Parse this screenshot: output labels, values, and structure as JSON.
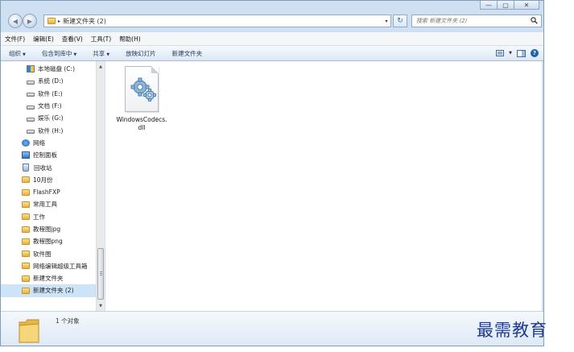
{
  "window": {
    "caption_buttons": {
      "minimize": "—",
      "maximize": "▢",
      "close": "✕"
    }
  },
  "address": {
    "path": "新建文件夹 (2)",
    "separator": "▸",
    "dropdown": "▾",
    "refresh": "↻"
  },
  "search": {
    "placeholder": "搜索 新建文件夹 (2)"
  },
  "menu": [
    "文件(F)",
    "编辑(E)",
    "查看(V)",
    "工具(T)",
    "帮助(H)"
  ],
  "toolbar": {
    "organize": "组织",
    "include_in_library": "包含到库中",
    "share": "共享",
    "slideshow": "放映幻灯片",
    "new_folder": "新建文件夹",
    "dropdown_arrow": "▼",
    "help": "?"
  },
  "nav": {
    "items": [
      {
        "label": "本地磁盘 (C:)",
        "icon": "system-drive-icon"
      },
      {
        "label": "系统 (D:)",
        "icon": "drive-icon"
      },
      {
        "label": "软件 (E:)",
        "icon": "drive-icon"
      },
      {
        "label": "文档 (F:)",
        "icon": "drive-icon"
      },
      {
        "label": "娱乐 (G:)",
        "icon": "drive-icon"
      },
      {
        "label": "软件 (H:)",
        "icon": "drive-icon"
      },
      {
        "label": "网络",
        "icon": "network-icon"
      },
      {
        "label": "控制面板",
        "icon": "control-panel-icon"
      },
      {
        "label": "回收站",
        "icon": "recycle-bin-icon"
      },
      {
        "label": "10月份",
        "icon": "folder-icon"
      },
      {
        "label": "FlashFXP",
        "icon": "folder-icon"
      },
      {
        "label": "常用工具",
        "icon": "folder-icon"
      },
      {
        "label": "工作",
        "icon": "folder-icon"
      },
      {
        "label": "教程图jpg",
        "icon": "folder-icon"
      },
      {
        "label": "教程图png",
        "icon": "folder-icon"
      },
      {
        "label": "软件图",
        "icon": "folder-icon"
      },
      {
        "label": "网络编辑超级工具箱",
        "icon": "folder-icon"
      },
      {
        "label": "新建文件夹",
        "icon": "folder-icon"
      },
      {
        "label": "新建文件夹 (2)",
        "icon": "folder-icon",
        "selected": true
      }
    ],
    "scroll_up": "▲",
    "scroll_down": "▼"
  },
  "content": {
    "files": [
      {
        "name": "WindowsCodecs.dll",
        "icon": "dll-gear-icon"
      }
    ]
  },
  "details": {
    "count": "1 个对象"
  },
  "watermark": "最需教育"
}
